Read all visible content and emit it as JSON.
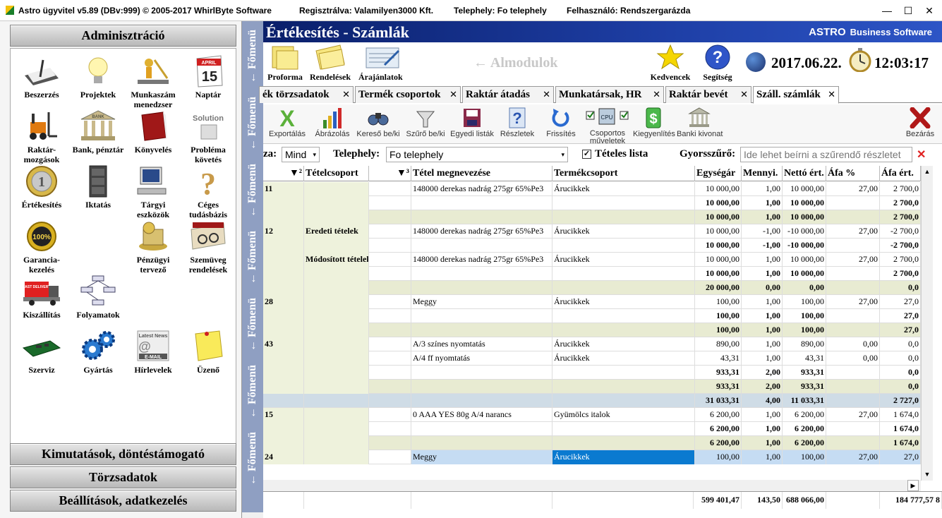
{
  "titlebar": {
    "app": "Astro ügyvitel v5.89 (DBv:999)  © 2005-2017 WhirlByte Software",
    "reg": "Regisztrálva: Valamilyen3000 Kft.",
    "site": "Telephely: Fo telephely",
    "user": "Felhasználó: Rendszergarázda",
    "minimize": "—",
    "maximize": "☐",
    "close": "✕"
  },
  "left": {
    "admin_title": "Adminisztráció",
    "bottom": [
      "Kimutatások, döntéstámogató",
      "Törzsadatok",
      "Beállítások, adatkezelés"
    ],
    "tiles": [
      {
        "label": "Beszerzés",
        "icon": "writing-pad-icon"
      },
      {
        "label": "Projektek",
        "icon": "lightbulb-icon"
      },
      {
        "label": "Munkaszám menedzser",
        "icon": "worker-icon"
      },
      {
        "label": "Naptár",
        "icon": "calendar-icon",
        "cal_month": "APRIL",
        "cal_day": "15"
      },
      {
        "label": "Raktár-mozgások",
        "icon": "forklift-icon"
      },
      {
        "label": "Bank, pénztár",
        "icon": "bank-icon",
        "bank_sign": "BANK"
      },
      {
        "label": "Könyvelés",
        "icon": "book-icon"
      },
      {
        "label": "Probléma követés",
        "icon": "solution-icon",
        "sign": "Solution"
      },
      {
        "label": "Értékesítés",
        "icon": "euro-coin-icon"
      },
      {
        "label": "Iktatás",
        "icon": "cabinet-icon"
      },
      {
        "label": "Tárgyi eszközök",
        "icon": "computer-icon"
      },
      {
        "label": "Céges tudásbázis",
        "icon": "question-icon"
      },
      {
        "label": "Garancia-kezelés",
        "icon": "guarantee-seal-icon",
        "seal": "100%"
      },
      {
        "label": "",
        "icon": ""
      },
      {
        "label": "Pénzügyi tervező",
        "icon": "money-icon"
      },
      {
        "label": "Szemüveg rendelések",
        "icon": "glasses-icon"
      },
      {
        "label": "Kiszállítás",
        "icon": "delivery-truck-icon",
        "truck_sign": "FAST DELIVERY"
      },
      {
        "label": "Folyamatok",
        "icon": "flowchart-icon"
      },
      {
        "label": "",
        "icon": ""
      },
      {
        "label": "",
        "icon": ""
      },
      {
        "label": "Szerviz",
        "icon": "circuit-board-icon"
      },
      {
        "label": "Gyártás",
        "icon": "gears-icon"
      },
      {
        "label": "Hírlevelek",
        "icon": "newsletter-icon",
        "news_sign": "Latest News",
        "mail_sign": "E-MAIL"
      },
      {
        "label": "Üzenő",
        "icon": "sticky-note-icon"
      }
    ]
  },
  "fomenu": {
    "label": "← Főmenü"
  },
  "main": {
    "banner": {
      "title": "Értékesítés - Számlák",
      "brand_a": "ASTRO",
      "brand_b": "Business Software"
    },
    "modules": [
      {
        "label": "Proforma"
      },
      {
        "label": "Rendelések"
      },
      {
        "label": "Árajánlatok"
      }
    ],
    "almodulok": "← Almodulok",
    "fav": "Kedvencek",
    "help": "Segítség",
    "date": "2017.06.22.",
    "time": "12:03:17",
    "tabs": [
      "ék törzsadatok",
      "Termék csoportok",
      "Raktár átadás",
      "Munkatársak, HR",
      "Raktár bevét",
      "Száll. számlák"
    ],
    "tab_close": "✕",
    "toolbar": [
      "Exportálás",
      "Ábrázolás",
      "Kereső be/ki",
      "Szűrő be/ki",
      "Egyedi listák",
      "Részletek",
      "Frissítés",
      "Csoportos műveletek",
      "Kiegyenlítés",
      "Banki kivonat",
      "Bezárás"
    ],
    "toolbar_cpu": "CPU",
    "filter": {
      "l1": "za:",
      "v1": "Mind",
      "l2": "Telephely:",
      "v2": "Fo telephely",
      "check": "Tételes lista",
      "checked": true,
      "l3": "Gyorsszűrő:",
      "placeholder": "Ide lehet beírni a szűrendő részletet"
    },
    "grid": {
      "headers": [
        "▼²",
        "Tételcsoport",
        "▼³",
        "Tétel megnevezése",
        "Termékcsoport",
        "Egységár",
        "Mennyi.",
        "Nettó ért.",
        "Áfa %",
        "Áfa ért."
      ],
      "rows": [
        {
          "t": "d",
          "c": [
            "11",
            "",
            "",
            "148000 derekas nadrág 275gr 65%Pe3",
            "Árucikkek",
            "10 000,00",
            "1,00",
            "10 000,00",
            "27,00",
            "2 700,0"
          ]
        },
        {
          "t": "s1",
          "c": [
            "",
            "",
            "",
            "",
            "",
            "10 000,00",
            "1,00",
            "10 000,00",
            "",
            "2 700,0"
          ]
        },
        {
          "t": "s2",
          "c": [
            "",
            "",
            "",
            "",
            "",
            "10 000,00",
            "1,00",
            "10 000,00",
            "",
            "2 700,0"
          ]
        },
        {
          "t": "d",
          "c": [
            "12",
            "Eredeti tételek",
            "",
            "148000 derekas nadrág 275gr 65%Pe3",
            "Árucikkek",
            "10 000,00",
            "-1,00",
            "-10 000,00",
            "27,00",
            "-2 700,0"
          ]
        },
        {
          "t": "s1",
          "c": [
            "",
            "",
            "",
            "",
            "",
            "10 000,00",
            "-1,00",
            "-10 000,00",
            "",
            "-2 700,0"
          ]
        },
        {
          "t": "d",
          "c": [
            "",
            "Módosított tételek",
            "",
            "148000 derekas nadrág 275gr 65%Pe3",
            "Árucikkek",
            "10 000,00",
            "1,00",
            "10 000,00",
            "27,00",
            "2 700,0"
          ]
        },
        {
          "t": "s1",
          "c": [
            "",
            "",
            "",
            "",
            "",
            "10 000,00",
            "1,00",
            "10 000,00",
            "",
            "2 700,0"
          ]
        },
        {
          "t": "s2",
          "c": [
            "",
            "",
            "",
            "",
            "",
            "20 000,00",
            "0,00",
            "0,00",
            "",
            "0,0"
          ]
        },
        {
          "t": "d",
          "c": [
            "28",
            "",
            "",
            "Meggy",
            "Árucikkek",
            "100,00",
            "1,00",
            "100,00",
            "27,00",
            "27,0"
          ]
        },
        {
          "t": "s1",
          "c": [
            "",
            "",
            "",
            "",
            "",
            "100,00",
            "1,00",
            "100,00",
            "",
            "27,0"
          ]
        },
        {
          "t": "s2",
          "c": [
            "",
            "",
            "",
            "",
            "",
            "100,00",
            "1,00",
            "100,00",
            "",
            "27,0"
          ]
        },
        {
          "t": "d",
          "c": [
            "43",
            "",
            "",
            "A/3 színes nyomtatás",
            "Árucikkek",
            "890,00",
            "1,00",
            "890,00",
            "0,00",
            "0,0"
          ]
        },
        {
          "t": "d",
          "c": [
            "",
            "",
            "",
            "A/4 ff nyomtatás",
            "Árucikkek",
            "43,31",
            "1,00",
            "43,31",
            "0,00",
            "0,0"
          ]
        },
        {
          "t": "s1",
          "c": [
            "",
            "",
            "",
            "",
            "",
            "933,31",
            "2,00",
            "933,31",
            "",
            "0,0"
          ]
        },
        {
          "t": "s2",
          "c": [
            "",
            "",
            "",
            "",
            "",
            "933,31",
            "2,00",
            "933,31",
            "",
            "0,0"
          ]
        },
        {
          "t": "s3",
          "c": [
            "",
            "",
            "",
            "",
            "",
            "31 033,31",
            "4,00",
            "11 033,31",
            "",
            "2 727,0"
          ]
        },
        {
          "t": "d",
          "c": [
            "15",
            "",
            "",
            "0 AAA YES 80g A/4  narancs",
            "Gyümölcs italok",
            "6 200,00",
            "1,00",
            "6 200,00",
            "27,00",
            "1 674,0"
          ]
        },
        {
          "t": "s1",
          "c": [
            "",
            "",
            "",
            "",
            "",
            "6 200,00",
            "1,00",
            "6 200,00",
            "",
            "1 674,0"
          ]
        },
        {
          "t": "s2",
          "c": [
            "",
            "",
            "",
            "",
            "",
            "6 200,00",
            "1,00",
            "6 200,00",
            "",
            "1 674,0"
          ]
        },
        {
          "t": "sel",
          "c": [
            "24",
            "",
            "",
            "Meggy",
            "Árucikkek",
            "100,00",
            "1,00",
            "100,00",
            "27,00",
            "27,0"
          ]
        }
      ],
      "totals": [
        "599 401,47",
        "143,50",
        "688 066,00",
        "",
        "184 777,57 8"
      ]
    }
  }
}
